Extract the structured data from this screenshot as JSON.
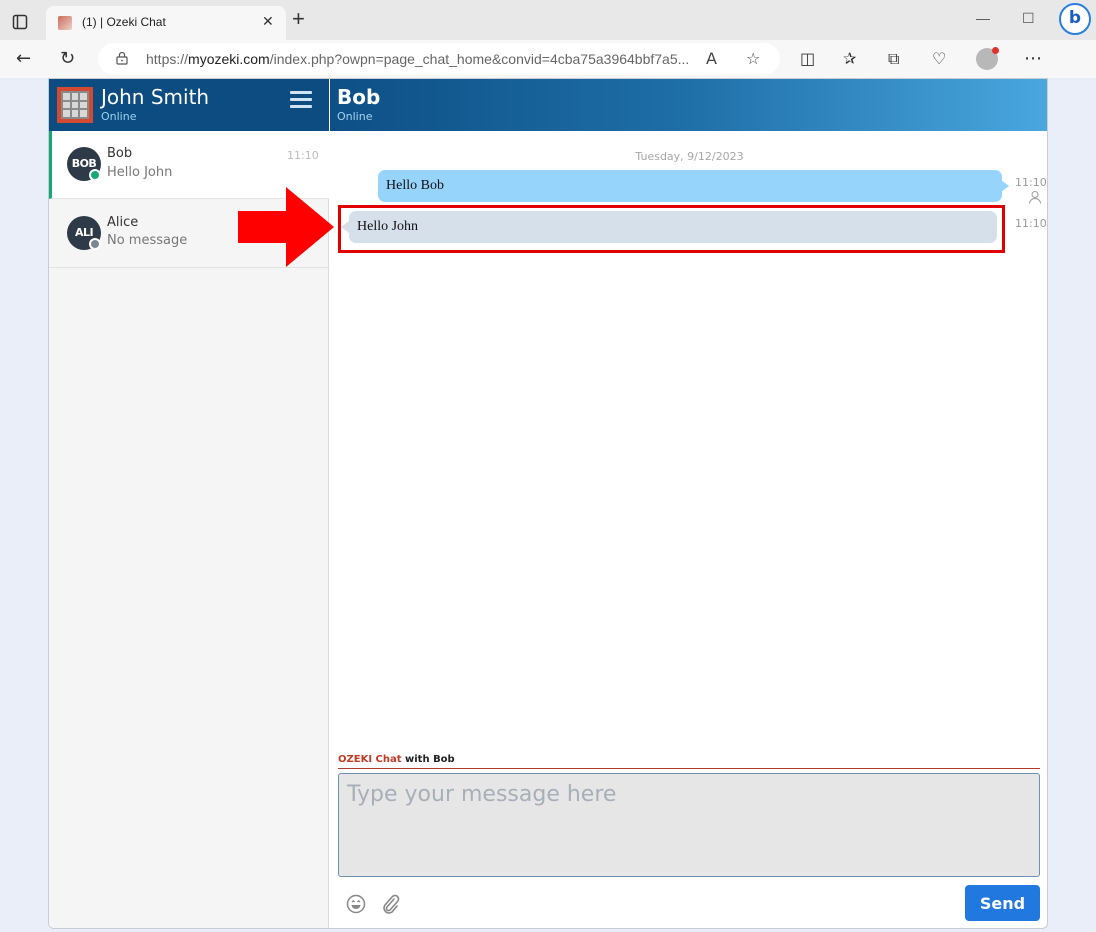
{
  "browser": {
    "tab_title": "(1) | Ozeki Chat",
    "url_prefix": "https://",
    "url_host": "myozeki.com",
    "url_path": "/index.php?owpn=page_chat_home&convid=4cba75a3964bbf7a5...",
    "icons": [
      "tab-actions-icon",
      "back-icon",
      "refresh-icon",
      "lock-icon",
      "read-aloud-icon",
      "favorite-star-icon",
      "split-screen-icon",
      "favorites-icon",
      "collections-icon",
      "browser-essentials-icon",
      "profile-icon",
      "more-icon",
      "bing-copilot-icon"
    ]
  },
  "sidebar": {
    "user_name": "John Smith",
    "user_status": "Online",
    "conversations": [
      {
        "initials": "BOB",
        "name": "Bob",
        "preview": "Hello John",
        "time": "11:10",
        "presence": "online",
        "presence_color": "#1aa777",
        "active": true
      },
      {
        "initials": "ALI",
        "name": "Alice",
        "preview": "No message",
        "time": "",
        "presence": "offline",
        "presence_color": "#7d8792",
        "active": false
      }
    ]
  },
  "chat": {
    "peer_name": "Bob",
    "peer_status": "Online",
    "date_separator": "Tuesday, 9/12/2023",
    "messages": [
      {
        "direction": "outgoing",
        "text": "Hello Bob",
        "time": "11:10"
      },
      {
        "direction": "incoming",
        "text": "Hello John",
        "time": "11:10",
        "highlighted": true
      }
    ]
  },
  "composer": {
    "brand": "OZEKI Chat",
    "with_label": "with Bob",
    "placeholder": "Type your message here",
    "value": "",
    "send_label": "Send"
  },
  "colors": {
    "header_dark": "#0d4c80",
    "accent_green": "#1aa777",
    "outgoing_bubble": "#96d4fb",
    "incoming_bubble": "#d5e0eb",
    "highlight_red": "#e00000",
    "send_button": "#2179e0"
  }
}
